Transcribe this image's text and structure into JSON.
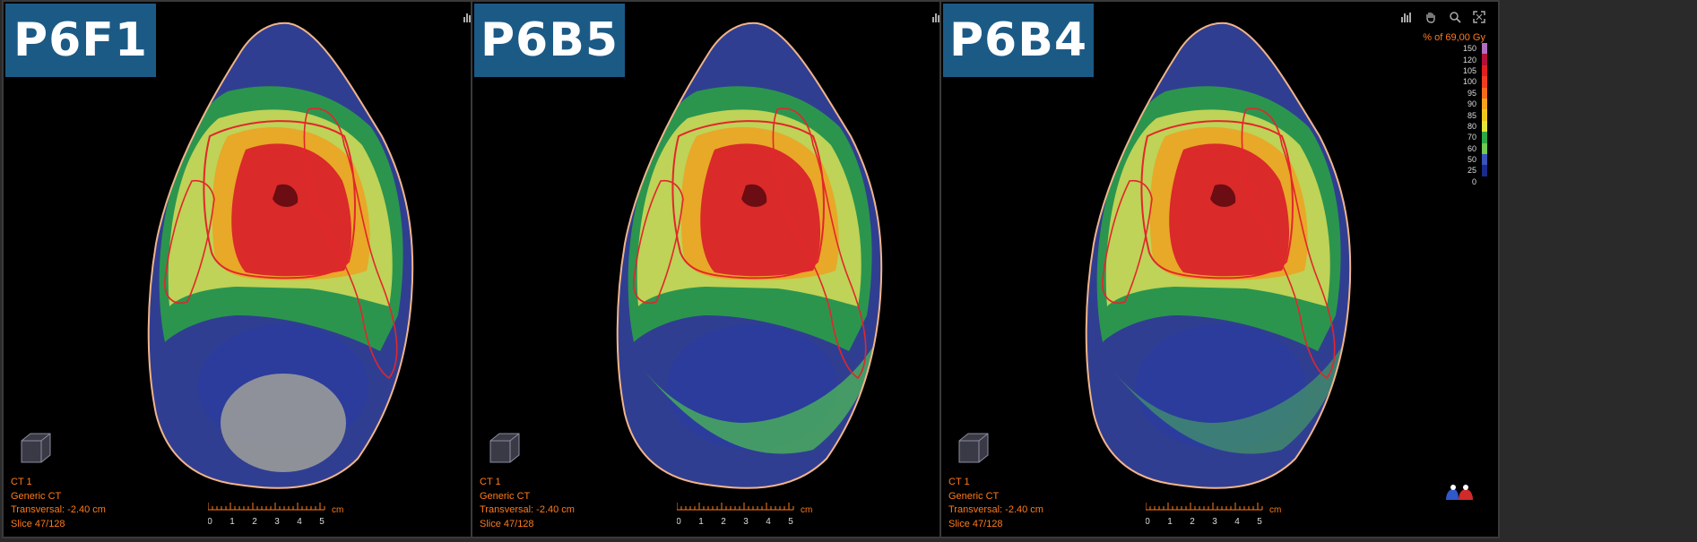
{
  "toolbar_icons": [
    "histogram-icon",
    "hand-icon",
    "zoom-icon",
    "fit-to-screen-icon"
  ],
  "legend": {
    "title": "% of 69,00 Gy",
    "levels": [
      {
        "label": "150",
        "color": "#b06ec0"
      },
      {
        "label": "120",
        "color": "#b0103a"
      },
      {
        "label": "105",
        "color": "#e0201e"
      },
      {
        "label": "100",
        "color": "#f03c20"
      },
      {
        "label": "95",
        "color": "#f56a1a"
      },
      {
        "label": "90",
        "color": "#f7a21a"
      },
      {
        "label": "85",
        "color": "#f0c81c"
      },
      {
        "label": "80",
        "color": "#e3e63a"
      },
      {
        "label": "70",
        "color": "#2ea845"
      },
      {
        "label": "60",
        "color": "#6fca4f"
      },
      {
        "label": "50",
        "color": "#3a53b8"
      },
      {
        "label": "25",
        "color": "#1a2a8c"
      },
      {
        "label": "0",
        "color": "#000000"
      }
    ]
  },
  "info_lines": [
    "CT 1",
    "Generic CT",
    "Transversal: -2.40 cm",
    "Slice 47/128"
  ],
  "ruler": {
    "unit": "cm",
    "ticks": [
      "0",
      "1",
      "2",
      "3",
      "4",
      "5"
    ]
  },
  "panels": [
    {
      "label": "P6F1"
    },
    {
      "label": "P6B5"
    },
    {
      "label": "P6B4"
    }
  ],
  "colors": {
    "accent": "#ff7a1a",
    "label_bg": "#1c5a86"
  }
}
